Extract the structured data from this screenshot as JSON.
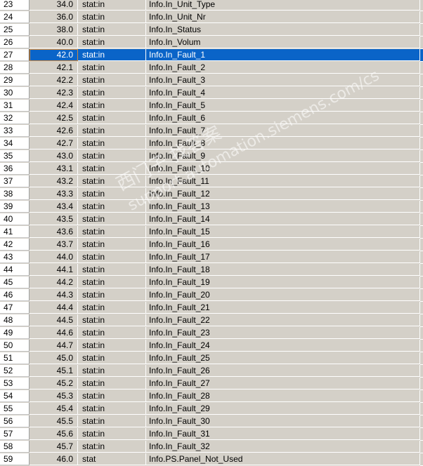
{
  "table": {
    "rows": [
      {
        "num": "23",
        "addr": "34.0",
        "decl": "stat:in",
        "name": "Info.In_Unit_Type"
      },
      {
        "num": "24",
        "addr": "36.0",
        "decl": "stat:in",
        "name": "Info.In_Unit_Nr"
      },
      {
        "num": "25",
        "addr": "38.0",
        "decl": "stat:in",
        "name": "Info.In_Status"
      },
      {
        "num": "26",
        "addr": "40.0",
        "decl": "stat:in",
        "name": "Info.In_Volum"
      },
      {
        "num": "27",
        "addr": "42.0",
        "decl": "stat:in",
        "name": "Info.In_Fault_1",
        "selected": true
      },
      {
        "num": "28",
        "addr": "42.1",
        "decl": "stat:in",
        "name": "Info.In_Fault_2"
      },
      {
        "num": "29",
        "addr": "42.2",
        "decl": "stat:in",
        "name": "Info.In_Fault_3"
      },
      {
        "num": "30",
        "addr": "42.3",
        "decl": "stat:in",
        "name": "Info.In_Fault_4"
      },
      {
        "num": "31",
        "addr": "42.4",
        "decl": "stat:in",
        "name": "Info.In_Fault_5"
      },
      {
        "num": "32",
        "addr": "42.5",
        "decl": "stat:in",
        "name": "Info.In_Fault_6"
      },
      {
        "num": "33",
        "addr": "42.6",
        "decl": "stat:in",
        "name": "Info.In_Fault_7"
      },
      {
        "num": "34",
        "addr": "42.7",
        "decl": "stat:in",
        "name": "Info.In_Fault_8"
      },
      {
        "num": "35",
        "addr": "43.0",
        "decl": "stat:in",
        "name": "Info.In_Fault_9"
      },
      {
        "num": "36",
        "addr": "43.1",
        "decl": "stat:in",
        "name": "Info.In_Fault_10"
      },
      {
        "num": "37",
        "addr": "43.2",
        "decl": "stat:in",
        "name": "Info.In_Fault_11"
      },
      {
        "num": "38",
        "addr": "43.3",
        "decl": "stat:in",
        "name": "Info.In_Fault_12"
      },
      {
        "num": "39",
        "addr": "43.4",
        "decl": "stat:in",
        "name": "Info.In_Fault_13"
      },
      {
        "num": "40",
        "addr": "43.5",
        "decl": "stat:in",
        "name": "Info.In_Fault_14"
      },
      {
        "num": "41",
        "addr": "43.6",
        "decl": "stat:in",
        "name": "Info.In_Fault_15"
      },
      {
        "num": "42",
        "addr": "43.7",
        "decl": "stat:in",
        "name": "Info.In_Fault_16"
      },
      {
        "num": "43",
        "addr": "44.0",
        "decl": "stat:in",
        "name": "Info.In_Fault_17"
      },
      {
        "num": "44",
        "addr": "44.1",
        "decl": "stat:in",
        "name": "Info.In_Fault_18"
      },
      {
        "num": "45",
        "addr": "44.2",
        "decl": "stat:in",
        "name": "Info.In_Fault_19"
      },
      {
        "num": "46",
        "addr": "44.3",
        "decl": "stat:in",
        "name": "Info.In_Fault_20"
      },
      {
        "num": "47",
        "addr": "44.4",
        "decl": "stat:in",
        "name": "Info.In_Fault_21"
      },
      {
        "num": "48",
        "addr": "44.5",
        "decl": "stat:in",
        "name": "Info.In_Fault_22"
      },
      {
        "num": "49",
        "addr": "44.6",
        "decl": "stat:in",
        "name": "Info.In_Fault_23"
      },
      {
        "num": "50",
        "addr": "44.7",
        "decl": "stat:in",
        "name": "Info.In_Fault_24"
      },
      {
        "num": "51",
        "addr": "45.0",
        "decl": "stat:in",
        "name": "Info.In_Fault_25"
      },
      {
        "num": "52",
        "addr": "45.1",
        "decl": "stat:in",
        "name": "Info.In_Fault_26"
      },
      {
        "num": "53",
        "addr": "45.2",
        "decl": "stat:in",
        "name": "Info.In_Fault_27"
      },
      {
        "num": "54",
        "addr": "45.3",
        "decl": "stat:in",
        "name": "Info.In_Fault_28"
      },
      {
        "num": "55",
        "addr": "45.4",
        "decl": "stat:in",
        "name": "Info.In_Fault_29"
      },
      {
        "num": "56",
        "addr": "45.5",
        "decl": "stat:in",
        "name": "Info.In_Fault_30"
      },
      {
        "num": "57",
        "addr": "45.6",
        "decl": "stat:in",
        "name": "Info.In_Fault_31"
      },
      {
        "num": "58",
        "addr": "45.7",
        "decl": "stat:in",
        "name": "Info.In_Fault_32"
      },
      {
        "num": "59",
        "addr": "46.0",
        "decl": "stat",
        "name": "Info.PS.Panel_Not_Used"
      }
    ]
  },
  "watermark": {
    "line1": "西门子 找答案",
    "line2": "support.automation.siemens.com/cs"
  },
  "colors": {
    "grid_bg": "#d4d0c8",
    "selection": "#0a64c8",
    "row_header_bg": "#ffffff"
  }
}
